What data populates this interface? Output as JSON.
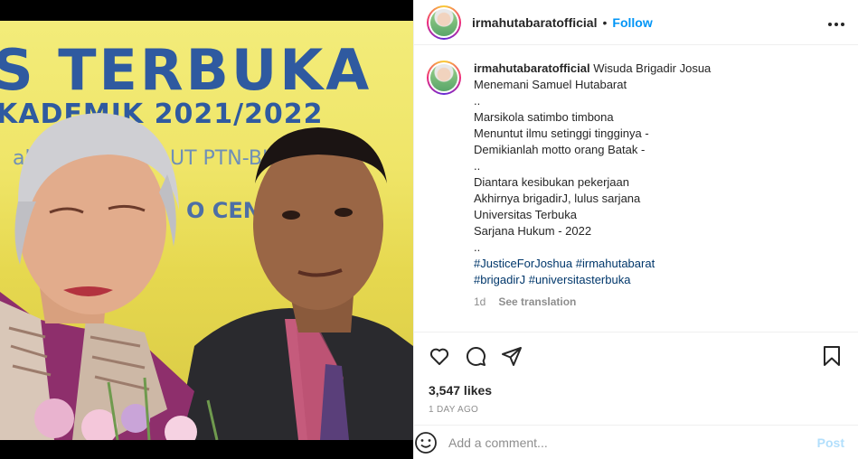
{
  "post": {
    "banner_line1": "S TERBUKA",
    "banner_line2": "KADEMIK 2021/2022",
    "banner_line3": "ala",
    "banner_line4": "UT PTN-BH",
    "banner_line5": "O   CENTE"
  },
  "header": {
    "username": "irmahutabaratofficial",
    "dot": "•",
    "follow_label": "Follow",
    "more_icon": "more-horizontal-icon"
  },
  "caption": {
    "username": "irmahutabaratofficial",
    "first_text": "Wisuda Brigadir Josua",
    "lines": [
      "Menemani Samuel Hutabarat",
      "..",
      "Marsikola satimbo timbona",
      "Menuntut ilmu setinggi tingginya -",
      "Demikianlah motto orang Batak -",
      "..",
      "Diantara kesibukan pekerjaan",
      "Akhirnya brigadirJ, lulus sarjana",
      "Universitas Terbuka",
      "Sarjana Hukum - 2022",
      ".."
    ],
    "hashtags": [
      "#JusticeForJoshua",
      "#irmahutabarat",
      "#brigadirJ",
      "#universitasterbuka"
    ],
    "time": "1d",
    "see_translation": "See translation"
  },
  "actions": {
    "likes": "3,547 likes",
    "ago": "1 DAY AGO",
    "icons": [
      "heart-icon",
      "comment-icon",
      "share-icon",
      "bookmark-icon"
    ]
  },
  "comment": {
    "placeholder": "Add a comment...",
    "post_label": "Post"
  },
  "colors": {
    "accent": "#0095f6",
    "post_disabled": "#b2dffc",
    "hashtag": "#00376b",
    "muted": "#8e8e8e"
  }
}
